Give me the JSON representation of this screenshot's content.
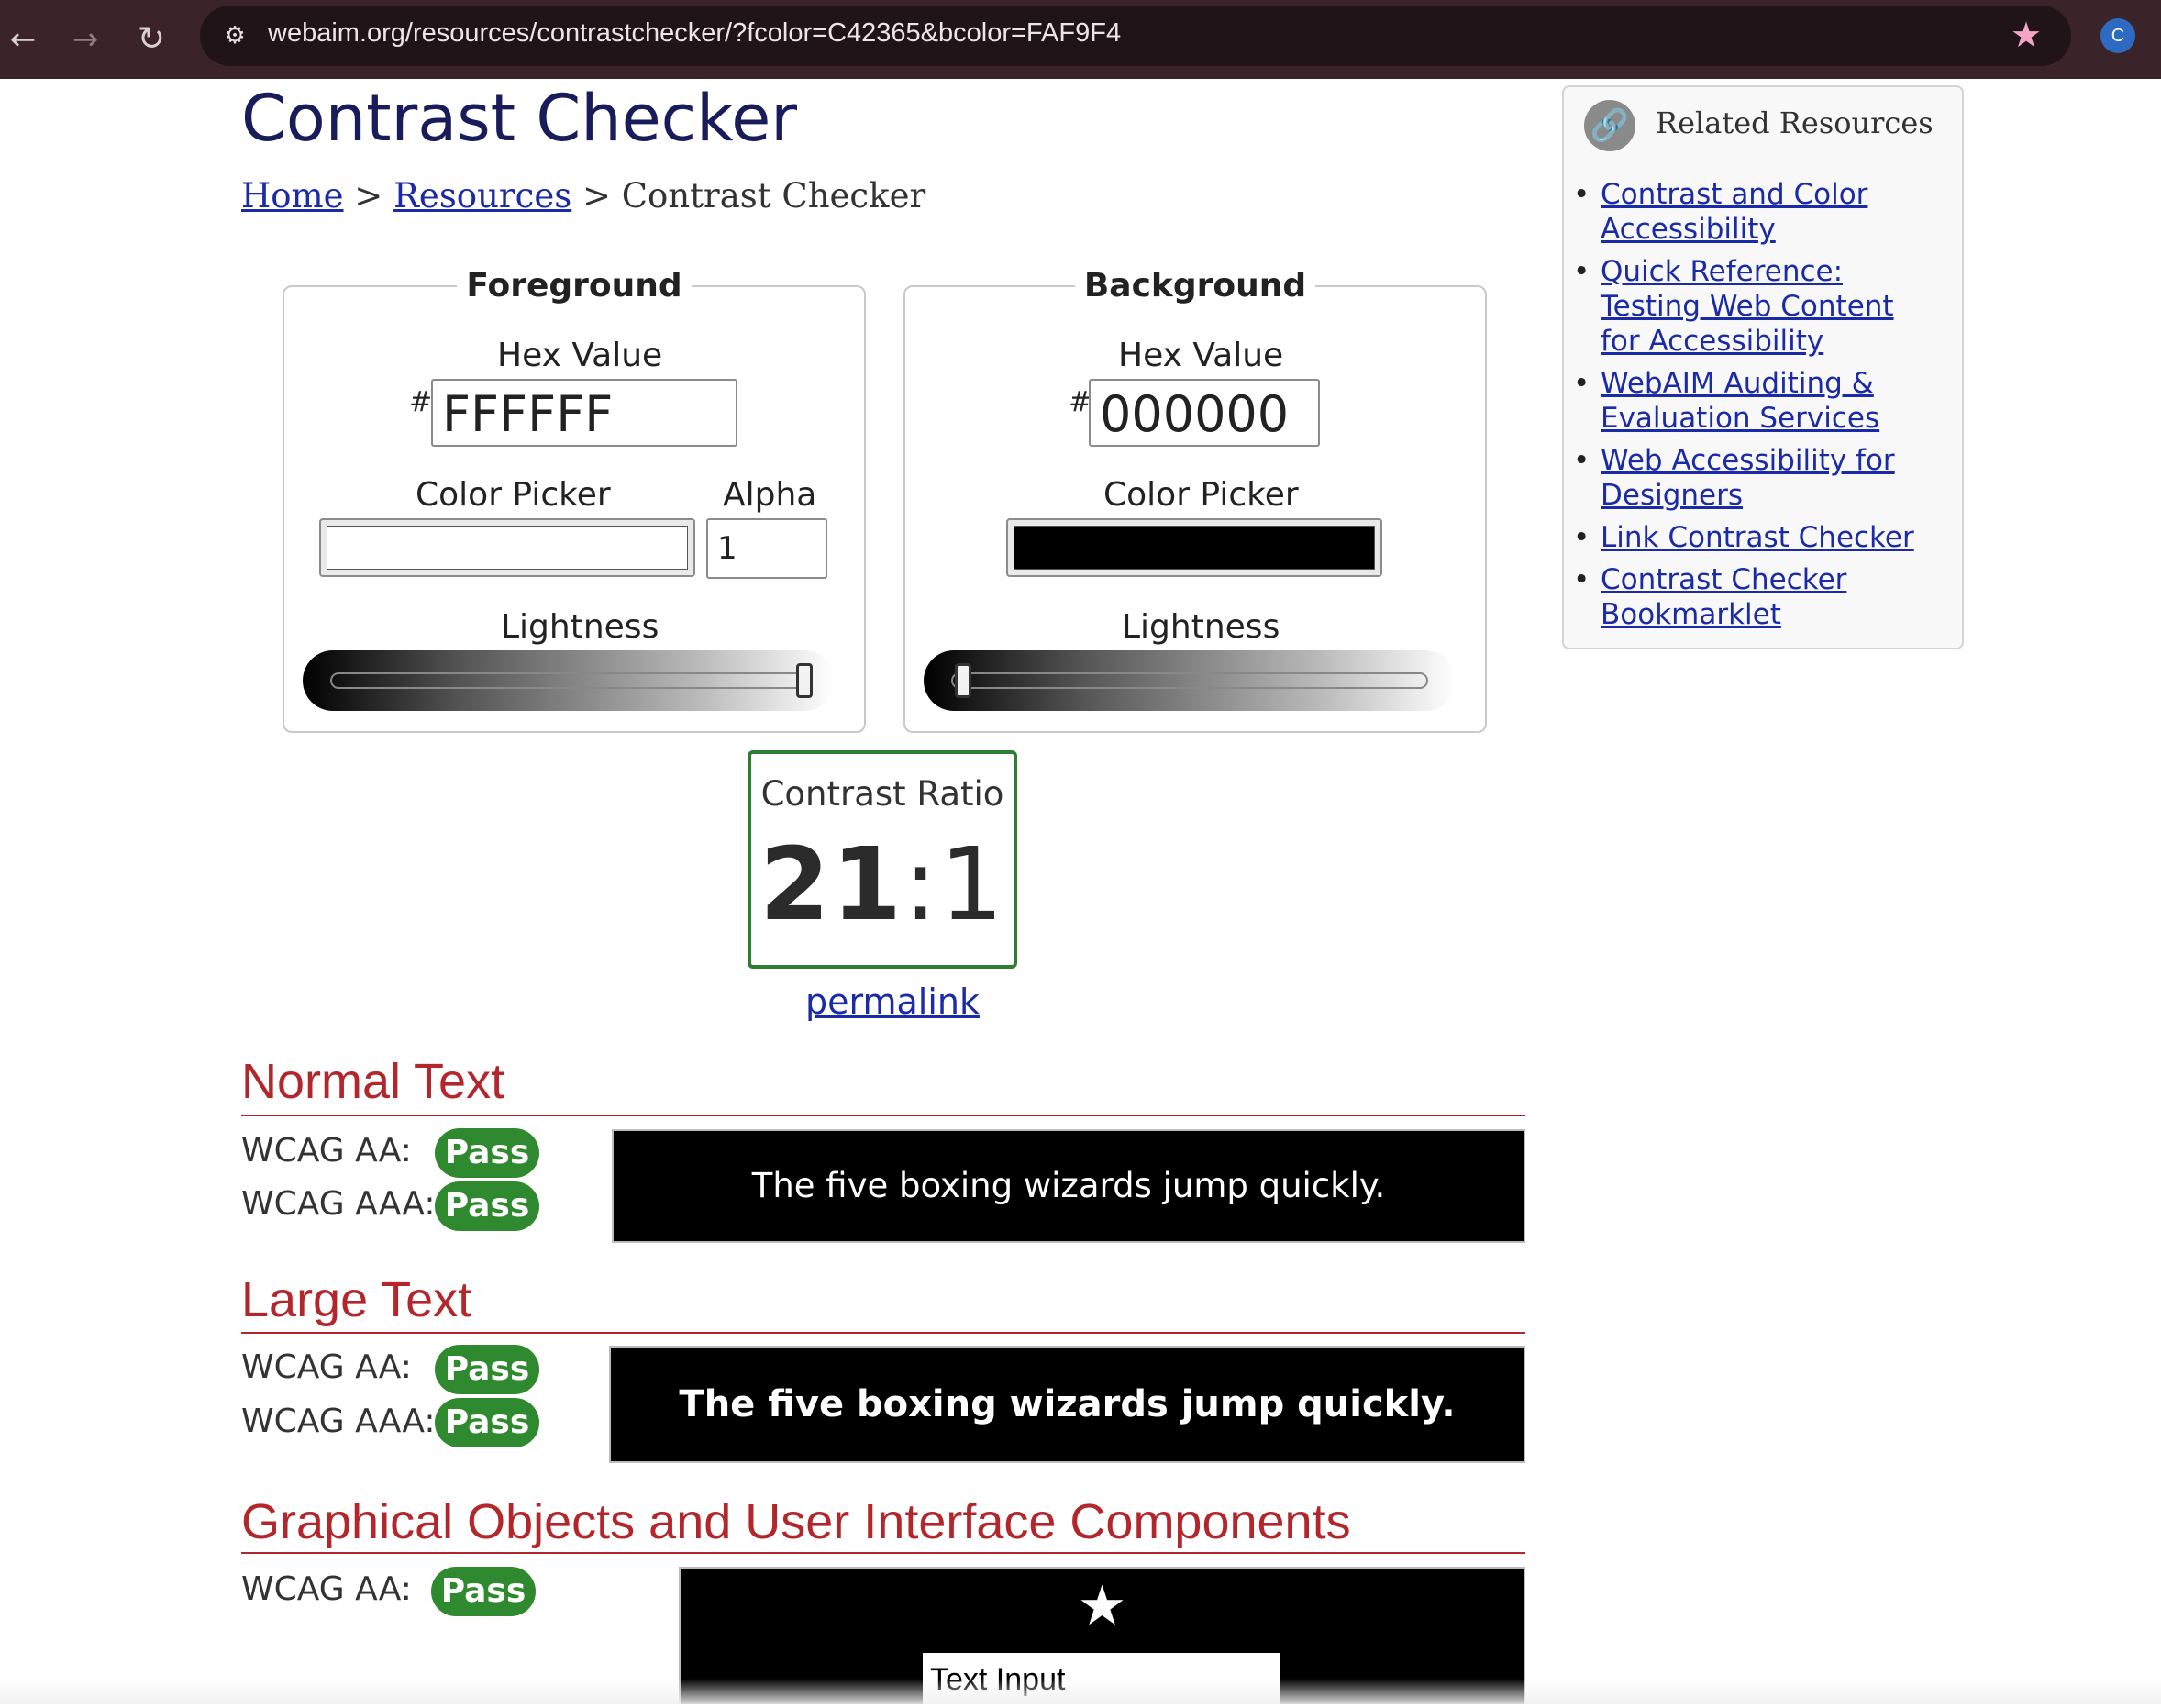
{
  "browser": {
    "url": "webaim.org/resources/contrastchecker/?fcolor=C42365&bcolor=FAF9F4",
    "back_icon": "←",
    "forward_icon": "→",
    "reload_icon": "↻",
    "site_info_icon": "⚙",
    "bookmark_icon": "★",
    "profile_initial": "C"
  },
  "page": {
    "title": "Contrast Checker",
    "breadcrumb": {
      "home": "Home",
      "sep": " > ",
      "resources": "Resources",
      "current": "Contrast Checker"
    }
  },
  "foreground": {
    "legend": "Foreground",
    "hex_label": "Hex Value",
    "hash": "#",
    "hex_value": "FFFFFF",
    "picker_label": "Color Picker",
    "alpha_label": "Alpha",
    "alpha_value": "1",
    "lightness_label": "Lightness",
    "color": "#ffffff"
  },
  "background": {
    "legend": "Background",
    "hex_label": "Hex Value",
    "hash": "#",
    "hex_value": "000000",
    "picker_label": "Color Picker",
    "lightness_label": "Lightness",
    "color": "#000000"
  },
  "contrast": {
    "label": "Contrast Ratio",
    "value_main": "21",
    "value_rest": ":1",
    "permalink": "permalink"
  },
  "normal_text": {
    "heading": "Normal Text",
    "aa_label": "WCAG AA:",
    "aa_result": "Pass",
    "aaa_label": "WCAG AAA:",
    "aaa_result": "Pass",
    "sample": "The five boxing wizards jump quickly."
  },
  "large_text": {
    "heading": "Large Text",
    "aa_label": "WCAG AA:",
    "aa_result": "Pass",
    "aaa_label": "WCAG AAA:",
    "aaa_result": "Pass",
    "sample": "The five boxing wizards jump quickly."
  },
  "graphical": {
    "heading": "Graphical Objects and User Interface Components",
    "aa_label": "WCAG AA:",
    "aa_result": "Pass",
    "star_icon": "★",
    "input_text": "Text Input"
  },
  "sidebar": {
    "title": "Related Resources",
    "icon": "🔗",
    "items": [
      {
        "label": "Contrast and Color Accessibility"
      },
      {
        "label": "Quick Reference: Testing Web Content for Accessibility"
      },
      {
        "label": "WebAIM Auditing & Evaluation Services"
      },
      {
        "label": "Web Accessibility for Designers"
      },
      {
        "label": "Link Contrast Checker"
      },
      {
        "label": "Contrast Checker Bookmarklet"
      }
    ]
  },
  "colors": {
    "pass_green": "#2f8a2f",
    "heading_red": "#b3262b",
    "link_blue": "#1b2aa6",
    "title_navy": "#181c5a",
    "chrome_bg": "#3a2329"
  }
}
